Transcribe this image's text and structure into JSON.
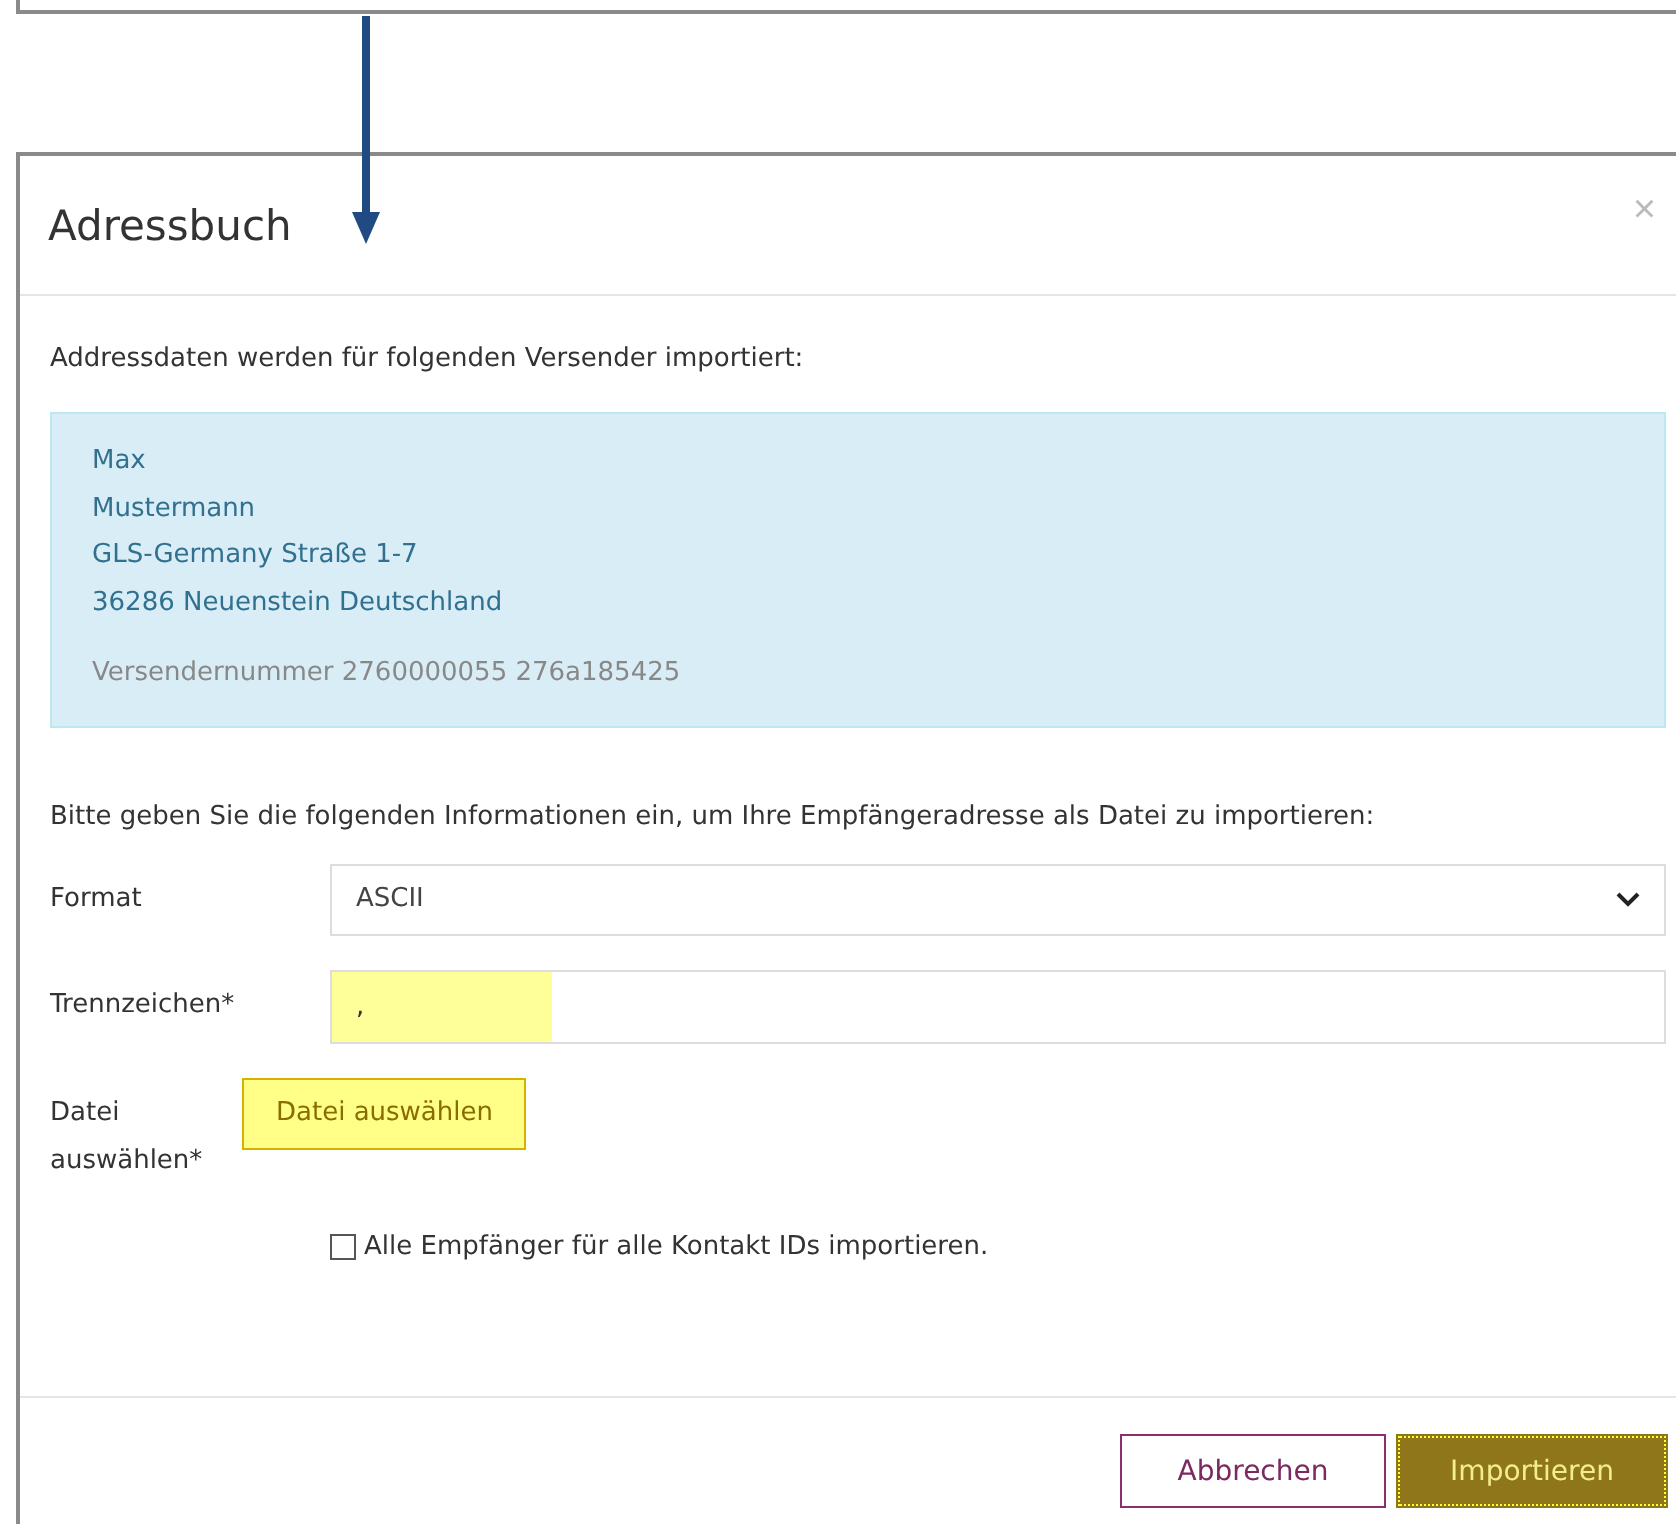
{
  "dialog": {
    "title": "Adressbuch",
    "close": "×",
    "intro": "Addressdaten werden für folgenden Versender importiert:",
    "sender": {
      "lines": [
        "Max",
        "Mustermann",
        "GLS-Germany Straße 1-7",
        "36286 Neuenstein Deutschland"
      ],
      "number": "Versendernummer 2760000055 276a185425"
    },
    "instruction": "Bitte geben Sie die folgenden Informationen ein, um Ihre Empfängeradresse als Datei zu importieren:",
    "fields": [
      {
        "kind": "select",
        "label": "Format",
        "value": "ASCII",
        "highlighted": false
      },
      {
        "kind": "text",
        "label": "Trennzeichen*",
        "value": ",",
        "highlighted": true
      },
      {
        "kind": "file",
        "label": "Datei auswählen*",
        "button": "Datei auswählen",
        "highlighted": true
      }
    ],
    "checkbox": {
      "label": "Alle Empfänger für alle Kontakt IDs importieren.",
      "checked": false
    },
    "buttons": [
      {
        "kind": "secondary",
        "label": "Abbrechen",
        "focused": false
      },
      {
        "kind": "primary",
        "label": "Importieren",
        "focused": true
      }
    ]
  }
}
